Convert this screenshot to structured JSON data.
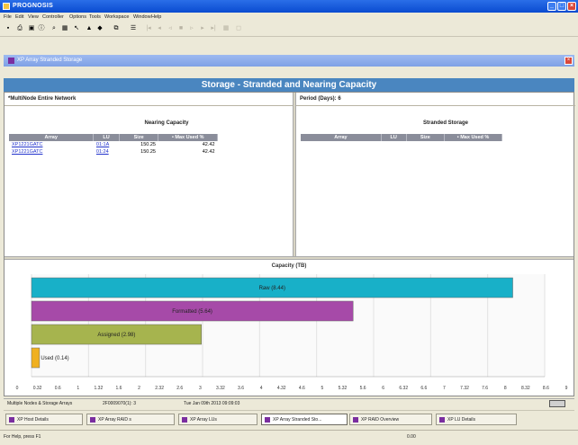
{
  "window": {
    "title": "PROGNOSIS"
  },
  "menu": [
    "File",
    "Edit",
    "View",
    "Controller",
    "Options",
    "Tools",
    "Workspace",
    "Window",
    "Help"
  ],
  "subwindow": {
    "title": "XP Array Stranded Storage"
  },
  "banner": "Storage - Stranded and Nearing Capacity",
  "network_label": "*MultiNode Entire Network",
  "period_label": "Period (Days): 6",
  "nearing": {
    "title": "Nearing Capacity",
    "columns": [
      "Array",
      "LU",
      "Size",
      "• Max Used %"
    ],
    "rows": [
      {
        "array": "XP1221GATC",
        "lu": "01:1A",
        "size": "150.25",
        "max_used": "42.42"
      },
      {
        "array": "XP1221GATC",
        "lu": "01:24",
        "size": "150.25",
        "max_used": "42.42"
      }
    ]
  },
  "stranded": {
    "title": "Stranded Storage",
    "columns": [
      "Array",
      "LU",
      "Size",
      "• Max Used %"
    ]
  },
  "chart_data": {
    "type": "bar",
    "orientation": "horizontal",
    "title": "Capacity (TB)",
    "categories": [
      "Raw (8.44)",
      "Formatted (5.64)",
      "Assigned (2.98)",
      "Used (0.14)"
    ],
    "values": [
      8.44,
      5.64,
      2.98,
      0.14
    ],
    "colors": [
      "#18b0c8",
      "#a64aa8",
      "#a6b44e",
      "#f0b020"
    ],
    "xlim": [
      0,
      9
    ],
    "xticks": [
      "0",
      "0.32",
      "0.6",
      "1",
      "1.32",
      "1.6",
      "2",
      "2.32",
      "2.6",
      "3",
      "3.32",
      "3.6",
      "4",
      "4.32",
      "4.6",
      "5",
      "5.32",
      "5.6",
      "6",
      "6.32",
      "6.6",
      "7",
      "7.32",
      "7.6",
      "8",
      "8.32",
      "8.6",
      "9"
    ],
    "grid": true
  },
  "status_row": {
    "nodes": "Multiple Nodes & Storage Arrays",
    "id": "2F0009070(1): 3",
    "date": "Tue Jan 09th 2013 09:09:03"
  },
  "tasks": [
    "XP Host Details",
    "XP Array RAID s",
    "XP Array LUs",
    "XP Array Stranded Sto...",
    "XP RAID Overview",
    "XP LU Details"
  ],
  "statusbar": {
    "help": "For Help, press F1",
    "mode": "0.00"
  },
  "colors": {
    "banner": "#4a86c0",
    "titlebar": "#0a4bd0"
  }
}
